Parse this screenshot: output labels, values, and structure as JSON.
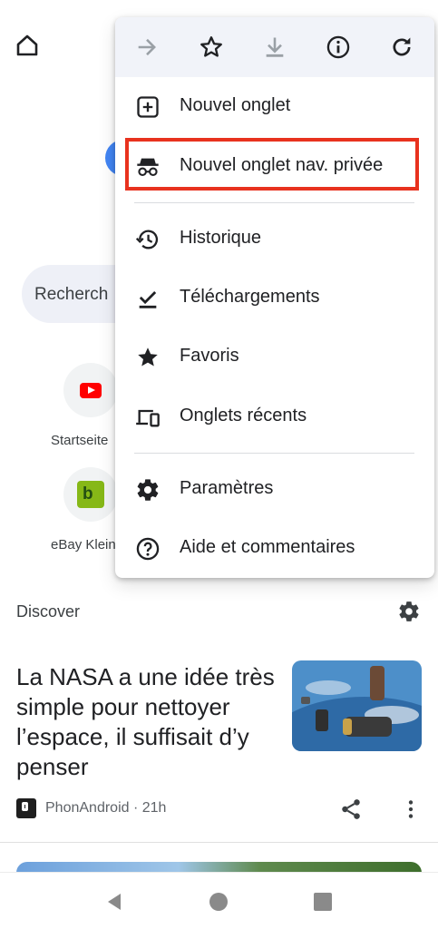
{
  "background": {
    "search_placeholder": "Recherch",
    "shortcuts": [
      {
        "label": "Startseite",
        "icon": "youtube-icon"
      },
      {
        "label": "eBay Klein",
        "icon": "kleinanzeigen-icon"
      }
    ],
    "discover": {
      "title": "Discover",
      "article": {
        "headline": "La NASA a une idée très simple pour nettoyer l’espace, il suffisait d’y penser",
        "source": "PhonAndroid · 21h"
      }
    }
  },
  "menu": {
    "toolbar": [
      {
        "name": "forward-button",
        "icon": "arrow-right-icon",
        "enabled": false
      },
      {
        "name": "bookmark-button",
        "icon": "star-outline-icon",
        "enabled": true
      },
      {
        "name": "download-page-button",
        "icon": "download-icon",
        "enabled": false
      },
      {
        "name": "page-info-button",
        "icon": "info-icon",
        "enabled": true
      },
      {
        "name": "reload-button",
        "icon": "refresh-icon",
        "enabled": true
      }
    ],
    "items": [
      {
        "label": "Nouvel onglet",
        "icon": "new-tab-icon"
      },
      {
        "label": "Nouvel onglet nav. privée",
        "icon": "incognito-icon",
        "highlighted": true
      },
      {
        "label": "Historique",
        "icon": "history-icon"
      },
      {
        "label": "Téléchargements",
        "icon": "downloads-icon"
      },
      {
        "label": "Favoris",
        "icon": "star-icon"
      },
      {
        "label": "Onglets récents",
        "icon": "devices-icon"
      },
      {
        "label": "Paramètres",
        "icon": "settings-icon"
      },
      {
        "label": "Aide et commentaires",
        "icon": "help-icon"
      }
    ],
    "highlight_color": "#e8321e"
  },
  "colors": {
    "menu_toolbar_bg": "#f1f3f9",
    "disabled_icon": "#9aa0a6",
    "text": "#202124"
  }
}
